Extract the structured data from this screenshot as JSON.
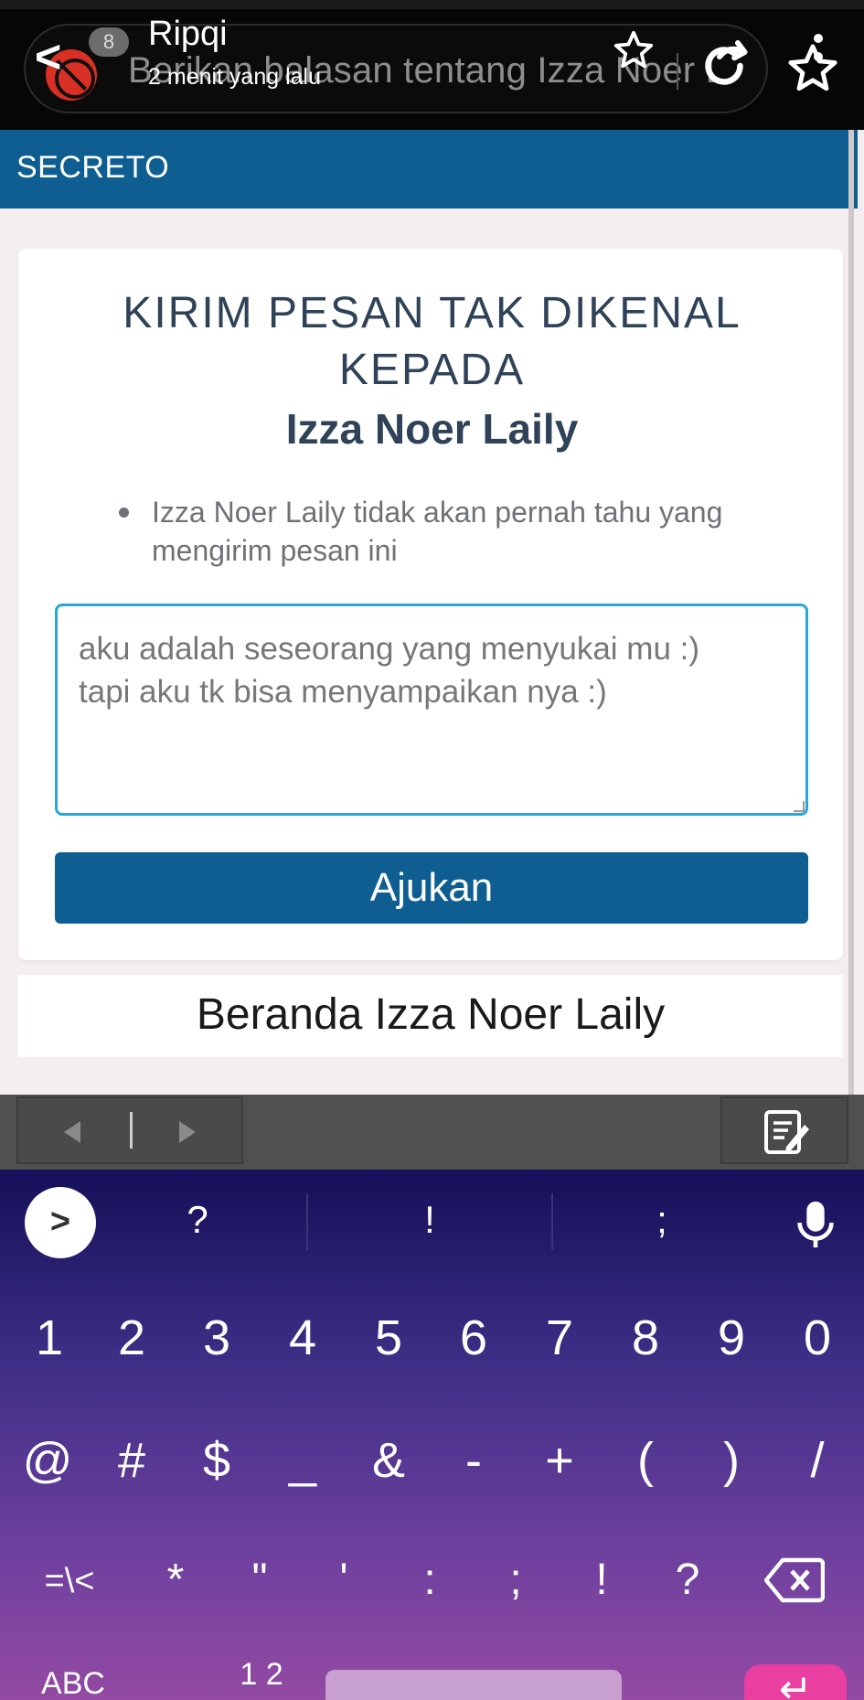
{
  "story_overlay": {
    "user_name": "Ripqi",
    "time_ago": "2 menit yang lalu",
    "badge_count": "8",
    "url_text": "Berikan balasan tentang Izza Noer L",
    "back_glyph": "<",
    "icons": [
      "back-icon",
      "adblock-icon",
      "star-icon",
      "reload-icon",
      "favorite-star-icon",
      "more-vertical-icon"
    ]
  },
  "site": {
    "brand": "SECRETO",
    "heading": "KIRIM PESAN TAK DIKENAL KEPADA",
    "heading_line1": "KIRIM PESAN TAK DIKENAL",
    "heading_line2": "KEPADA",
    "recipient": "Izza Noer Laily",
    "bullet_line1": "Izza Noer Laily tidak akan pernah tahu yang",
    "bullet_line2": "mengirim pesan ini",
    "message_value_line1": "aku adalah seseorang yang menyukai mu :)",
    "message_value_line2": "tapi aku tk bisa menyampaikan nya :)",
    "submit_label": "Ajukan",
    "home_link": "Beranda Izza Noer Laily",
    "colors": {
      "primary": "#0e5e92",
      "heading": "#2f4257",
      "input_border": "#2aa7d6",
      "background": "#f4eef0"
    }
  },
  "keyboard_toolbar": {
    "icons": [
      "cursor-left-icon",
      "cursor-right-icon",
      "clipboard-edit-icon"
    ]
  },
  "keyboard": {
    "suggestion_arrow": ">",
    "suggestions": [
      "?",
      "!",
      ";"
    ],
    "row1": [
      "1",
      "2",
      "3",
      "4",
      "5",
      "6",
      "7",
      "8",
      "9",
      "0"
    ],
    "row2": [
      "@",
      "#",
      "$",
      "_",
      "&",
      "-",
      "+",
      "(",
      ")",
      "/"
    ],
    "row3": [
      "=\\<",
      "*",
      "\"",
      "'",
      ":",
      ";",
      "!",
      "?"
    ],
    "row4_left": "ABC",
    "row4_numeric": "1 2",
    "enter_glyph": "↵",
    "colors": {
      "top": "#150f58",
      "bottom": "#934aa3",
      "enter": "#e83fa0"
    }
  }
}
